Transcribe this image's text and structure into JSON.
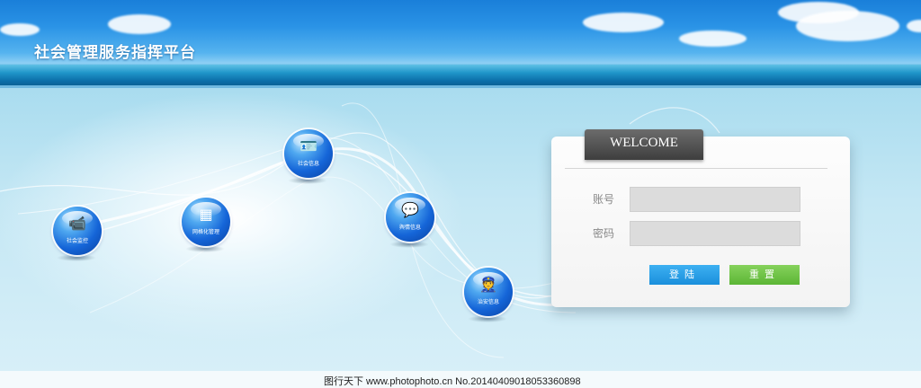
{
  "header": {
    "title": "社会管理服务指挥平台"
  },
  "nav_orbs": [
    {
      "label": "社会监控",
      "icon": "camera-icon",
      "glyph": "📹"
    },
    {
      "label": "网格化管理",
      "icon": "grid-icon",
      "glyph": "▦"
    },
    {
      "label": "社会信息",
      "icon": "id-card-icon",
      "glyph": "🪪"
    },
    {
      "label": "舆情信息",
      "icon": "chat-bubble-icon",
      "glyph": "💬"
    },
    {
      "label": "治安信息",
      "icon": "police-icon",
      "glyph": "👮"
    }
  ],
  "login": {
    "welcome": "WELCOME",
    "account_label": "账号",
    "account_value": "",
    "password_label": "密码",
    "password_value": "",
    "login_button": "登陆",
    "reset_button": "重置"
  },
  "footer": {
    "watermark": "图行天下 www.photophoto.cn No.20140409018053360898"
  },
  "colors": {
    "login_button": "#1a8fdc",
    "reset_button": "#5bb535",
    "orb": "#1565d8"
  }
}
